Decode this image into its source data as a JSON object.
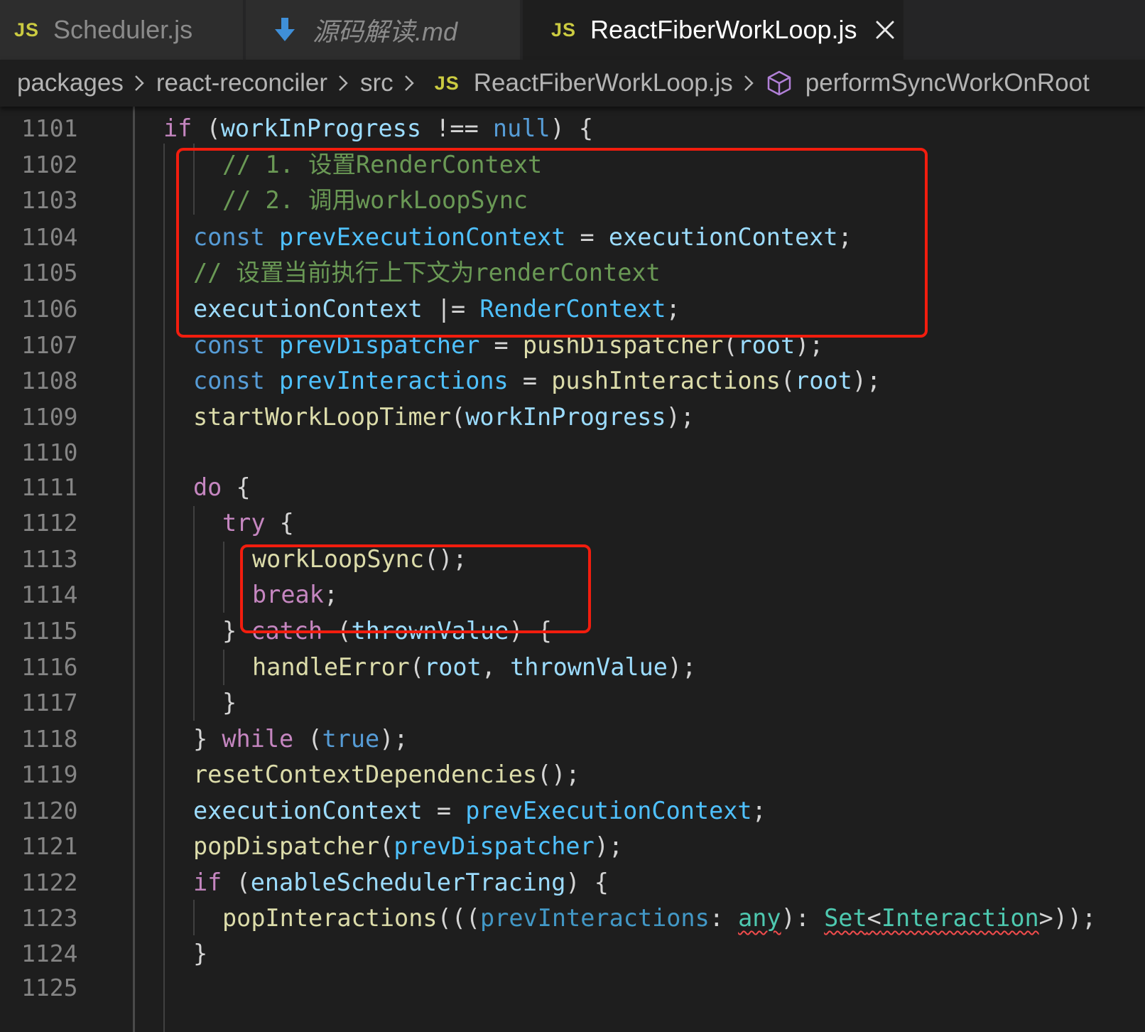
{
  "tabs": [
    {
      "icon": "JS",
      "label": "Scheduler.js",
      "active": false
    },
    {
      "icon": "download-arrow-icon",
      "label": "源码解读.md",
      "active": false
    },
    {
      "icon": "JS",
      "label": "ReactFiberWorkLoop.js",
      "active": true
    }
  ],
  "breadcrumb": {
    "items": [
      "packages",
      "react-reconciler",
      "src"
    ],
    "file_icon": "JS",
    "file": "ReactFiberWorkLoop.js",
    "symbol_icon": "cube-icon",
    "symbol": "performSyncWorkOnRoot"
  },
  "line_numbers": [
    "1101",
    "1102",
    "1103",
    "1104",
    "1105",
    "1106",
    "1107",
    "1108",
    "1109",
    "1110",
    "1111",
    "1112",
    "1113",
    "1114",
    "1115",
    "1116",
    "1117",
    "1118",
    "1119",
    "1120",
    "1121",
    "1122",
    "1123",
    "1124",
    "1125"
  ],
  "code": {
    "l1101": {
      "t0": "if",
      "t1": " (",
      "t2": "workInProgress",
      "t3": " !== ",
      "t4": "null",
      "t5": ") {"
    },
    "l1102": {
      "t0": "// 1. 设置RenderContext"
    },
    "l1103": {
      "t0": "// 2. 调用workLoopSync"
    },
    "l1104": {
      "t0": "const",
      "t1": " ",
      "t2": "prevExecutionContext",
      "t3": " = ",
      "t4": "executionContext",
      "t5": ";"
    },
    "l1105": {
      "t0": "// 设置当前执行上下文为renderContext"
    },
    "l1106": {
      "t0": "executionContext",
      "t1": " |= ",
      "t2": "RenderContext",
      "t3": ";"
    },
    "l1107": {
      "t0": "const",
      "t1": " ",
      "t2": "prevDispatcher",
      "t3": " = ",
      "t4": "pushDispatcher",
      "t5": "(",
      "t6": "root",
      "t7": ");"
    },
    "l1108": {
      "t0": "const",
      "t1": " ",
      "t2": "prevInteractions",
      "t3": " = ",
      "t4": "pushInteractions",
      "t5": "(",
      "t6": "root",
      "t7": ");"
    },
    "l1109": {
      "t0": "startWorkLoopTimer",
      "t1": "(",
      "t2": "workInProgress",
      "t3": ");"
    },
    "l1111": {
      "t0": "do",
      "t1": " {"
    },
    "l1112": {
      "t0": "try",
      "t1": " {"
    },
    "l1113": {
      "t0": "workLoopSync",
      "t1": "();"
    },
    "l1114": {
      "t0": "break",
      "t1": ";"
    },
    "l1115": {
      "t0": "} ",
      "t1": "catch",
      "t2": " (",
      "t3": "thrownValue",
      "t4": ") {"
    },
    "l1116": {
      "t0": "handleError",
      "t1": "(",
      "t2": "root",
      "t3": ", ",
      "t4": "thrownValue",
      "t5": ");"
    },
    "l1117": {
      "t0": "}"
    },
    "l1118": {
      "t0": "} ",
      "t1": "while",
      "t2": " (",
      "t3": "true",
      "t4": ");"
    },
    "l1119": {
      "t0": "resetContextDependencies",
      "t1": "();"
    },
    "l1120": {
      "t0": "executionContext",
      "t1": " = ",
      "t2": "prevExecutionContext",
      "t3": ";"
    },
    "l1121": {
      "t0": "popDispatcher",
      "t1": "(",
      "t2": "prevDispatcher",
      "t3": ");"
    },
    "l1122": {
      "t0": "if",
      "t1": " (",
      "t2": "enableSchedulerTracing",
      "t3": ") {"
    },
    "l1123": {
      "t0": "popInteractions",
      "t1": "(((",
      "t2": "prevInteractions",
      "t3": ": ",
      "t4": "any",
      "t5": "): ",
      "t6": "Set",
      "t7": "<",
      "t8": "Interaction",
      "t9": ">));"
    },
    "l1124": {
      "t0": "}"
    }
  },
  "colors": {
    "background": "#1e1e1e",
    "highlight_box": "#f21d0e",
    "keyword": "#569cd6",
    "control_keyword": "#c586c0",
    "variable": "#9cdcfe",
    "constant": "#4fc1ff",
    "function": "#dcdcaa",
    "comment": "#6a9955",
    "type": "#4ec9b0"
  }
}
